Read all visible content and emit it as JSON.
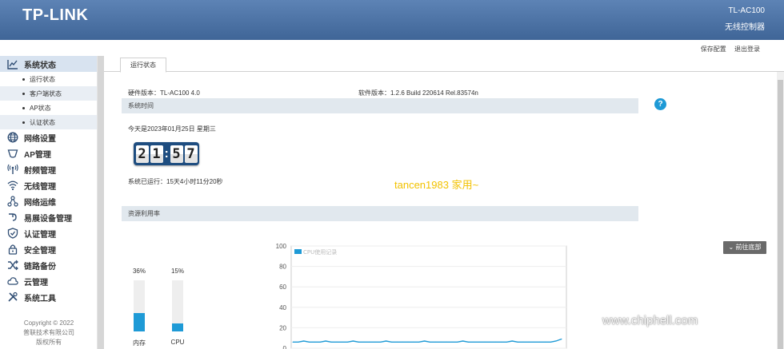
{
  "header": {
    "brand": "TP-LINK",
    "model": "TL-AC100",
    "subtitle": "无线控制器",
    "links": [
      "保存配置",
      "退出登录"
    ]
  },
  "sidebar": {
    "items": [
      {
        "label": "系统状态",
        "icon": "chart-line-icon",
        "active": true,
        "children": [
          "运行状态",
          "客户端状态",
          "AP状态",
          "认证状态"
        ]
      },
      {
        "label": "网络设置",
        "icon": "globe-icon"
      },
      {
        "label": "AP管理",
        "icon": "ap-icon"
      },
      {
        "label": "射频管理",
        "icon": "antenna-icon"
      },
      {
        "label": "无线管理",
        "icon": "wifi-icon"
      },
      {
        "label": "网络运维",
        "icon": "network-ops-icon"
      },
      {
        "label": "易展设备管理",
        "icon": "mesh-device-icon"
      },
      {
        "label": "认证管理",
        "icon": "shield-check-icon"
      },
      {
        "label": "安全管理",
        "icon": "lock-icon"
      },
      {
        "label": "链路备份",
        "icon": "shuffle-icon"
      },
      {
        "label": "云管理",
        "icon": "cloud-icon"
      },
      {
        "label": "系统工具",
        "icon": "tools-icon"
      }
    ],
    "copyright": [
      "Copyright © 2022",
      "普联技术有限公司",
      "版权所有"
    ]
  },
  "main": {
    "tab": "运行状态",
    "hardware": "硬件版本：TL-AC100 4.0",
    "software": "软件版本：1.2.6 Build 220614 Rel.83574n",
    "section_time": "系统时间",
    "today": "今天是2023年01月25日 星期三",
    "clock": [
      "2",
      "1",
      "5",
      "7"
    ],
    "uptime": "系统已运行：15天4小时11分20秒",
    "overlay_text": "tancen1983 家用~",
    "section_resource": "资源利用率",
    "goto_bottom": "前往底部",
    "meters": [
      {
        "label": "内存",
        "percent_text": "36%",
        "value": 36
      },
      {
        "label": "CPU",
        "percent_text": "15%",
        "value": 15
      }
    ]
  },
  "chart_data": {
    "type": "line",
    "legend": "CPU使用记录",
    "ylim": [
      0,
      100
    ],
    "yticks": [
      0,
      20,
      40,
      60,
      80,
      100
    ],
    "values": [
      6,
      6,
      7,
      6,
      6,
      6,
      7,
      6,
      6,
      6,
      6,
      7,
      6,
      6,
      6,
      6,
      6,
      7,
      6,
      6,
      6,
      6,
      6,
      6,
      7,
      6,
      6,
      6,
      6,
      6,
      6,
      7,
      6,
      6,
      6,
      6,
      6,
      6,
      6,
      6,
      7,
      6,
      6,
      6,
      6,
      6,
      6,
      6,
      7,
      9
    ],
    "color": "#1e9ad6"
  },
  "watermark": {
    "logo_text": "chip hell",
    "url": "www.chiphell.com"
  }
}
